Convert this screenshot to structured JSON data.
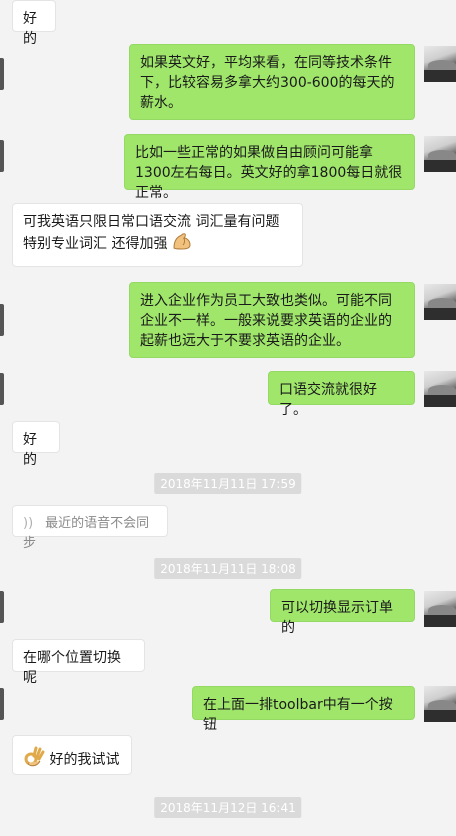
{
  "messages": [
    {
      "side": "left",
      "text": "好的"
    },
    {
      "side": "right",
      "text": "如果英文好，平均来看，在同等技术条件下，比较容易多拿大约300-600的每天的薪水。"
    },
    {
      "side": "right",
      "text": "比如一些正常的如果做自由顾问可能拿1300左右每日。英文好的拿1800每日就很正常。"
    },
    {
      "side": "left",
      "text": "可我英语只限日常口语交流 词汇量有问题特别专业词汇 还得加强",
      "emoji": "flexed-biceps"
    },
    {
      "side": "right",
      "text": "进入企业作为员工大致也类似。可能不同企业不一样。一般来说要求英语的企业的起薪也远大于不要求英语的企业。"
    },
    {
      "side": "right",
      "text": "口语交流就很好了。"
    },
    {
      "side": "left",
      "text": "好的"
    },
    {
      "side": "time",
      "text": "2018年11月11日 17:59"
    },
    {
      "side": "left",
      "text": "最近的语音不会同步",
      "icon": "voice-icon"
    },
    {
      "side": "time",
      "text": "2018年11月11日 18:08"
    },
    {
      "side": "right",
      "text": "可以切换显示订单的"
    },
    {
      "side": "left",
      "text": "在哪个位置切换呢"
    },
    {
      "side": "right",
      "text": "在上面一排toolbar中有一个按钮"
    },
    {
      "side": "left",
      "text": "好的我试试",
      "emoji": "ok-hand"
    },
    {
      "side": "time",
      "text": "2018年11月12日 16:41"
    }
  ],
  "colors": {
    "background": "#f3f3f3",
    "sent_bubble": "#9fe66b",
    "received_bubble": "#ffffff",
    "timestamp_bg": "#dadada"
  }
}
